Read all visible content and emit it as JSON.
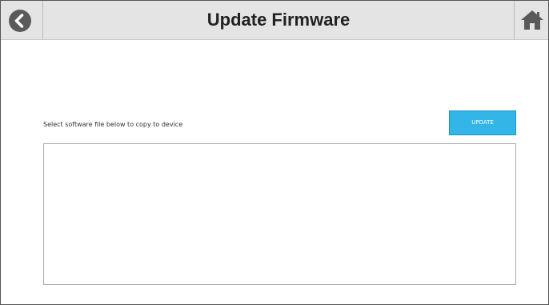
{
  "header": {
    "title": "Update Firmware",
    "back_icon": "chevron-left-circle-icon",
    "home_icon": "home-icon"
  },
  "main": {
    "instruction": "Select software file below to copy to device",
    "update_label": "UPDATE",
    "file_list": []
  },
  "colors": {
    "header_bg": "#e4e4e4",
    "accent": "#33b5e8",
    "icon": "#5a5a5a"
  }
}
